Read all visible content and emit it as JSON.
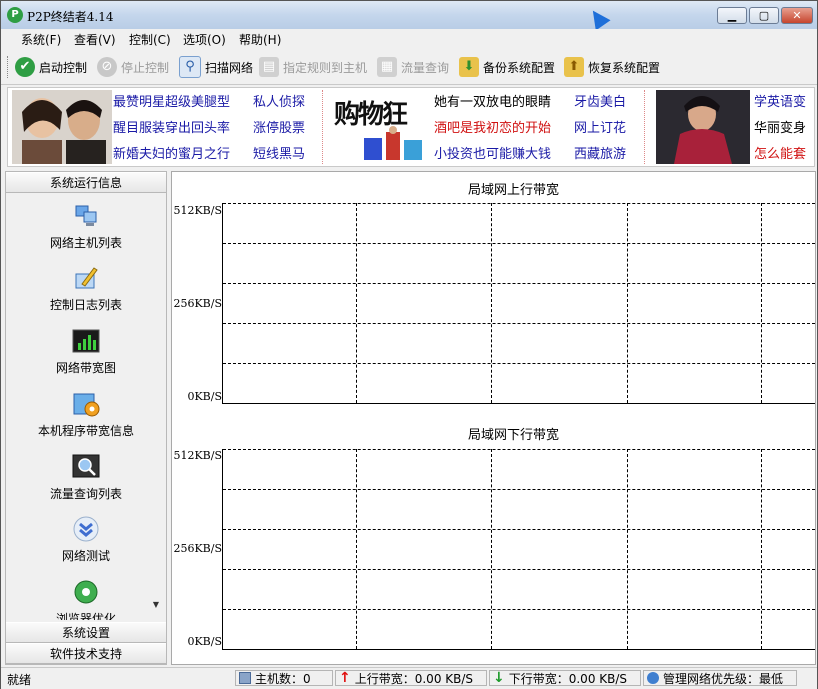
{
  "window": {
    "title": "P2P终结者4.14"
  },
  "menu": [
    "系统(F)",
    "查看(V)",
    "控制(C)",
    "选项(O)",
    "帮助(H)"
  ],
  "toolbar": {
    "start": "启动控制",
    "stop": "停止控制",
    "scan": "扫描网络",
    "assign": "指定规则到主机",
    "traffic": "流量查询",
    "backup": "备份系统配置",
    "restore": "恢复系统配置"
  },
  "ads": {
    "col1": [
      "最赞明星超级美腿型",
      "醒目服装穿出回头率",
      "新婚夫妇的蜜月之行"
    ],
    "col2": [
      "私人侦探",
      "涨停股票",
      "短线黑马"
    ],
    "banner": "购物狂",
    "col3": [
      "她有一双放电的眼睛",
      "酒吧是我初恋的开始",
      "小投资也可能赚大钱"
    ],
    "col4": [
      "牙齿美白",
      "网上订花",
      "西藏旅游"
    ],
    "col5": [
      "学英语变",
      "华丽变身",
      "怎么能套"
    ]
  },
  "sidebar": {
    "header": "系统运行信息",
    "items": [
      "网络主机列表",
      "控制日志列表",
      "网络带宽图",
      "本机程序带宽信息",
      "流量查询列表",
      "网络测试",
      "浏览器优化"
    ],
    "footer1": "系统设置",
    "footer2": "软件技术支持"
  },
  "graphs": {
    "upload": {
      "title": "局域网上行带宽",
      "ticks": [
        "512KB/S",
        "256KB/S",
        "0KB/S"
      ]
    },
    "download": {
      "title": "局域网下行带宽",
      "ticks": [
        "512KB/S",
        "256KB/S",
        "0KB/S"
      ]
    }
  },
  "status": {
    "ready": "就绪",
    "hosts": "主机数：0",
    "up": "上行带宽：0.00 KB/S",
    "down": "下行带宽：0.00 KB/S",
    "priority": "管理网络优先级：最低"
  },
  "colors": {
    "link": "#1a1aa6",
    "hot_link": "#d01010",
    "up_arrow": "#e01010",
    "down_arrow": "#1d9a2a"
  }
}
